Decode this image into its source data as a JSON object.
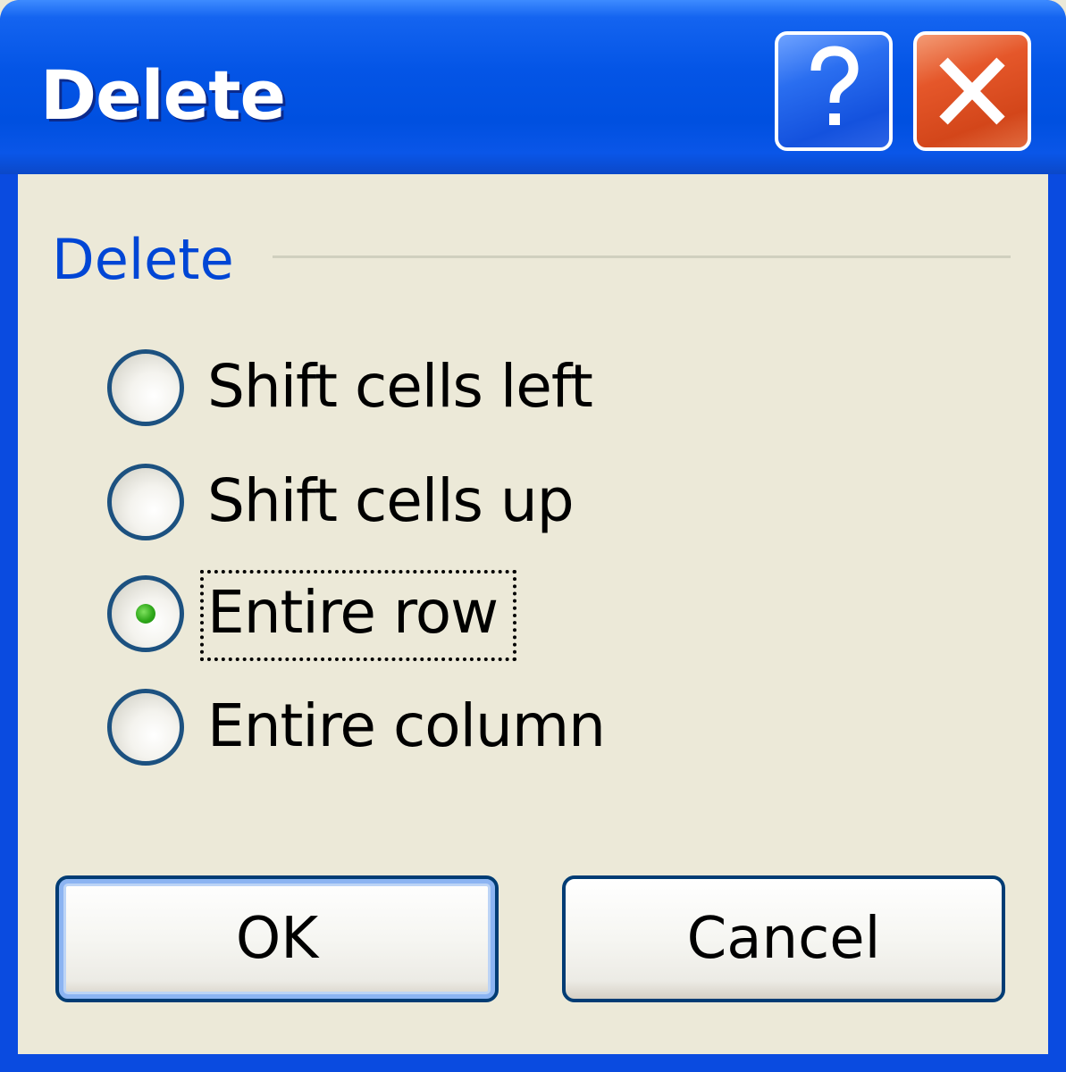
{
  "window": {
    "title": "Delete",
    "help_icon": "question-mark-icon",
    "close_icon": "close-x-icon"
  },
  "group": {
    "label": "Delete"
  },
  "options": [
    {
      "label": "Shift cells left",
      "selected": false
    },
    {
      "label": "Shift cells up",
      "selected": false
    },
    {
      "label": "Entire row",
      "selected": true
    },
    {
      "label": "Entire column",
      "selected": false
    }
  ],
  "buttons": {
    "ok_label": "OK",
    "cancel_label": "Cancel"
  },
  "colors": {
    "titlebar": "#0050e0",
    "group_label": "#0046d5",
    "close_button": "#d3461a",
    "selected_dot": "#2fa81a"
  }
}
